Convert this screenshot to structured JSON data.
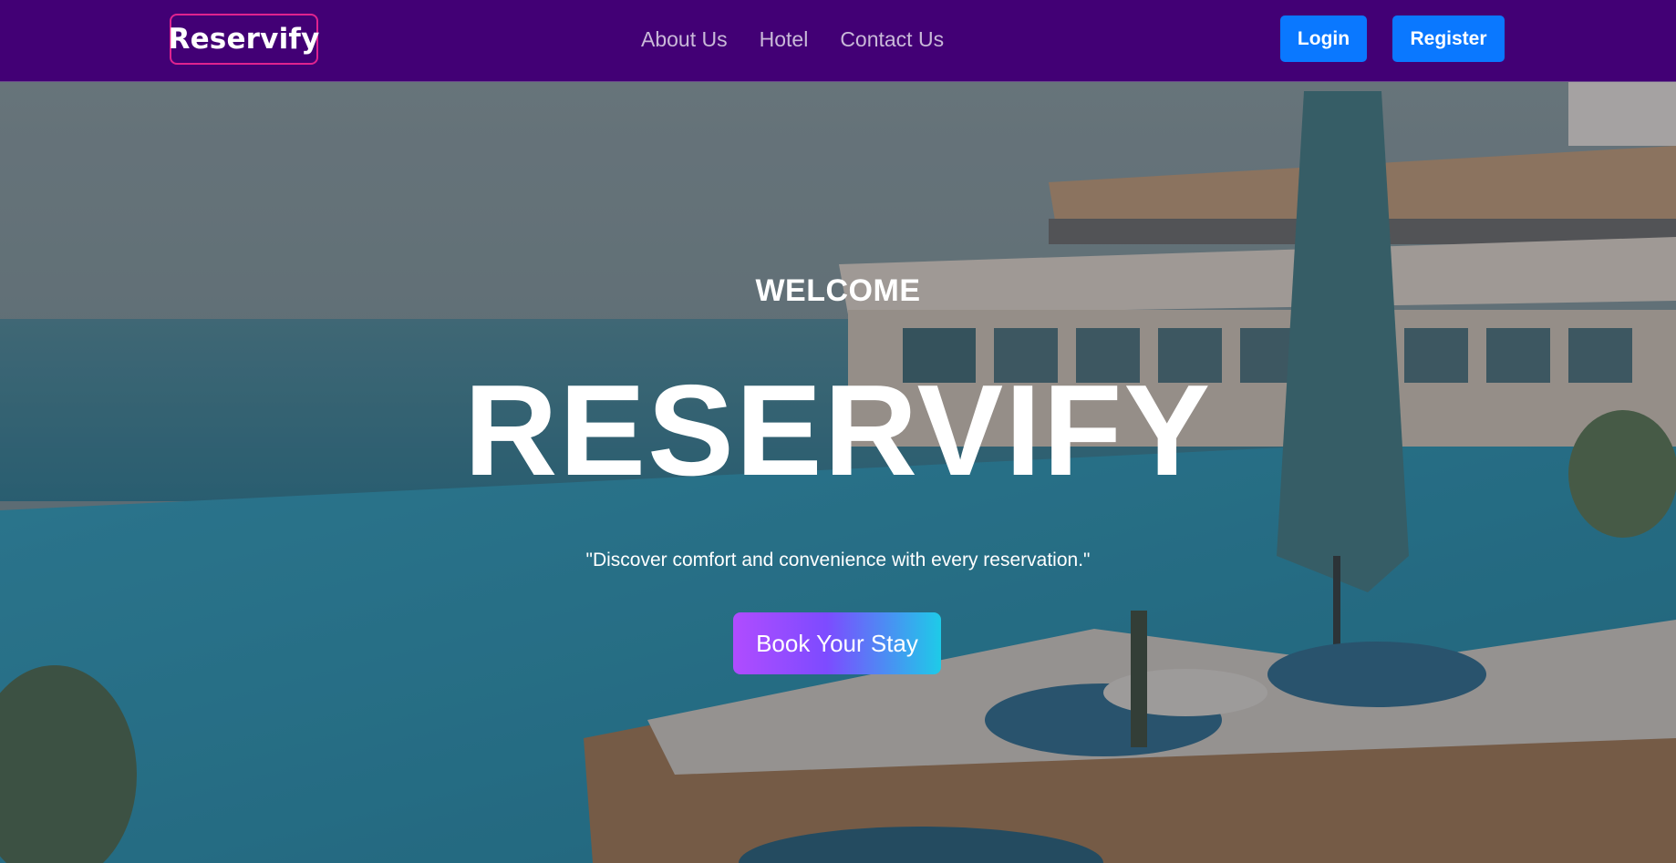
{
  "navbar": {
    "brand": "Reservify",
    "links": [
      "About Us",
      "Hotel",
      "Contact Us"
    ],
    "login_label": "Login",
    "register_label": "Register"
  },
  "hero": {
    "welcome": "WELCOME",
    "title": "RESERVIFY",
    "tagline": "\"Discover comfort and convenience with every reservation.\"",
    "cta_label": "Book Your Stay"
  },
  "colors": {
    "navbar_bg": "#420075",
    "brand_border": "#e0238f",
    "button_blue": "#0a78ff",
    "cta_gradient_start": "#b04cff",
    "cta_gradient_end": "#1ecbe8"
  }
}
